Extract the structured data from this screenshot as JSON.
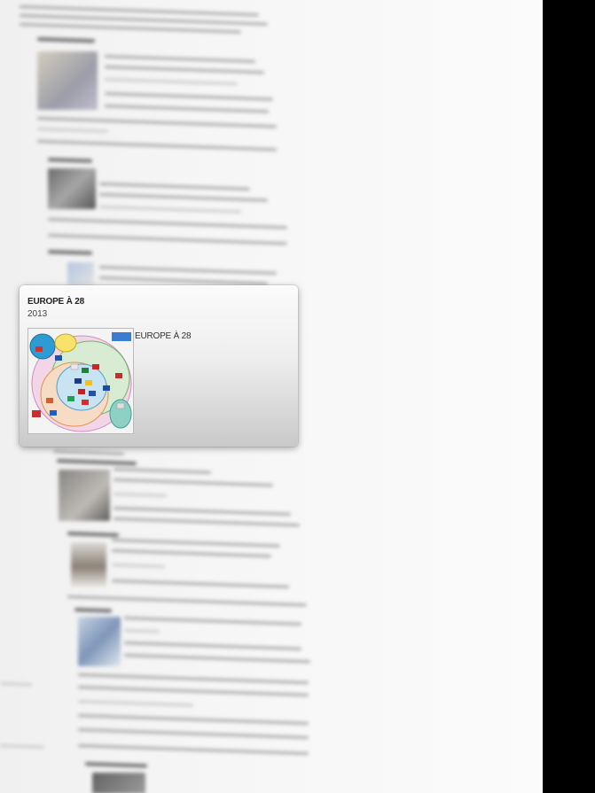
{
  "popup": {
    "title": "EUROPE À 28",
    "year": "2013",
    "caption": "EUROPE À 28",
    "thumbnail_icon": "euler-diagram-europe-thumbnail"
  },
  "colors": {
    "right_bar": "#000000",
    "page_background": "#f4f4f4",
    "card_gradient_top": "#fbfbfb",
    "card_gradient_bottom": "#c9c9c9"
  }
}
